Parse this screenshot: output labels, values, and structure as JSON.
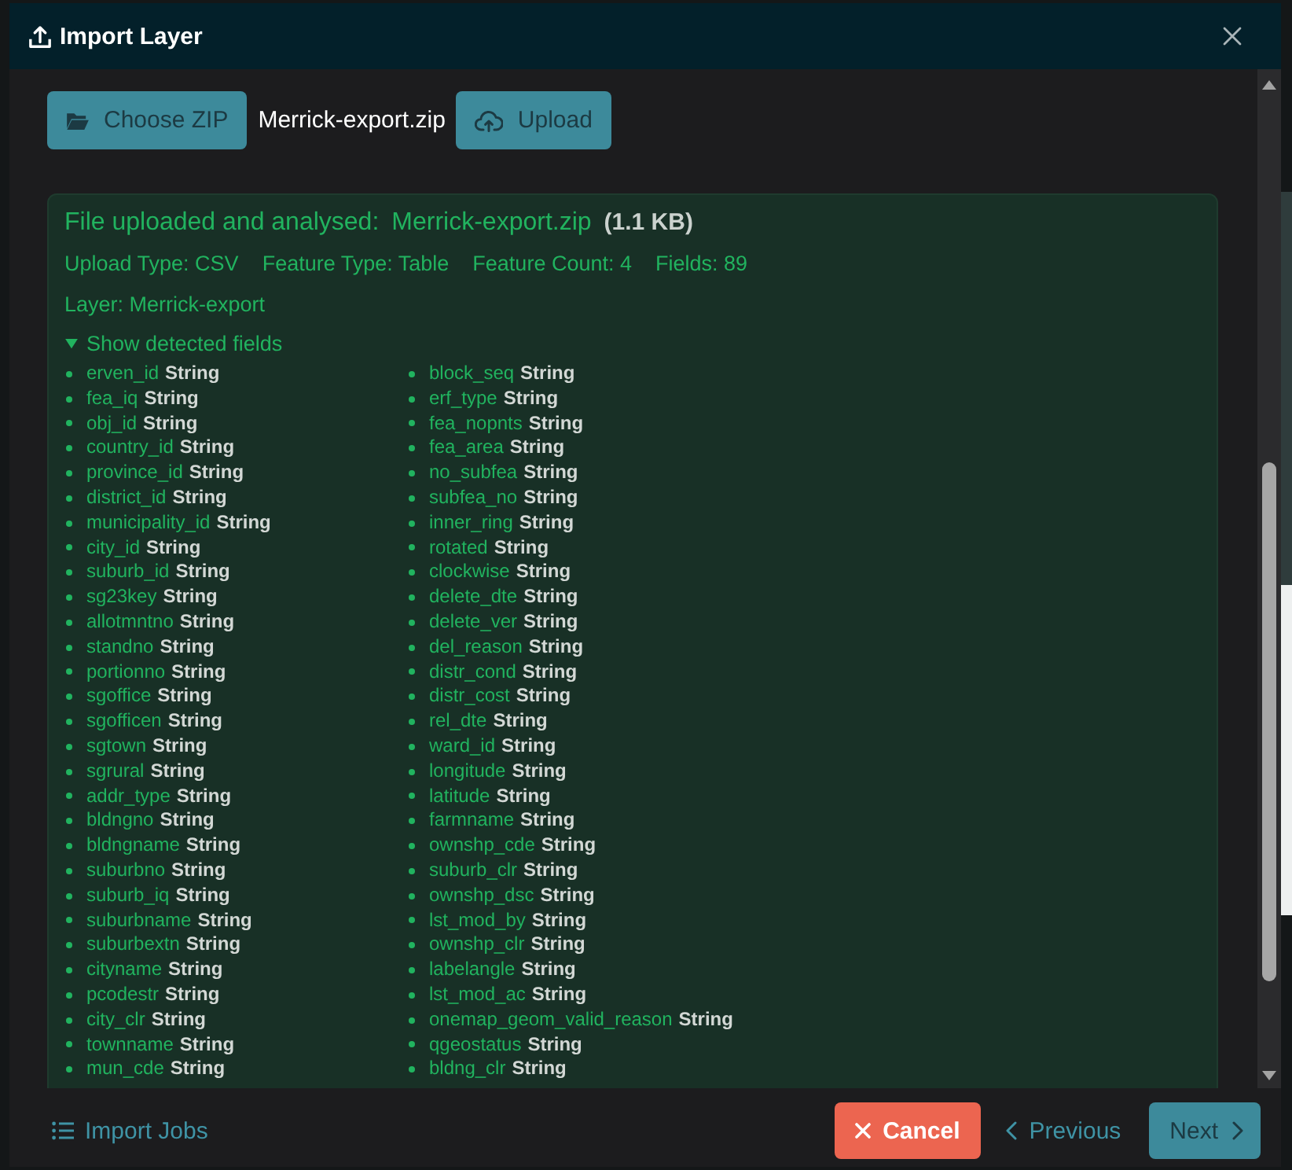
{
  "window": {
    "title": "Import Layer"
  },
  "toolbar": {
    "choose_button": "Choose ZIP",
    "file_name": "Merrick-export.zip",
    "upload_button": "Upload"
  },
  "result": {
    "heading": "File uploaded and analysed:",
    "file_name": "Merrick-export.zip",
    "size": "(1.1 KB)",
    "stats": [
      "Upload Type: CSV",
      "Feature Type: Table",
      "Feature Count: 4",
      "Fields: 89"
    ],
    "layer": "Layer: Merrick-export",
    "fields_toggle": {
      "label": "Show detected fields",
      "expanded": true
    },
    "fields": [
      {
        "name": "erven_id",
        "type": "String"
      },
      {
        "name": "fea_iq",
        "type": "String"
      },
      {
        "name": "obj_id",
        "type": "String"
      },
      {
        "name": "country_id",
        "type": "String"
      },
      {
        "name": "province_id",
        "type": "String"
      },
      {
        "name": "district_id",
        "type": "String"
      },
      {
        "name": "municipality_id",
        "type": "String"
      },
      {
        "name": "city_id",
        "type": "String"
      },
      {
        "name": "suburb_id",
        "type": "String"
      },
      {
        "name": "sg23key",
        "type": "String"
      },
      {
        "name": "allotmntno",
        "type": "String"
      },
      {
        "name": "standno",
        "type": "String"
      },
      {
        "name": "portionno",
        "type": "String"
      },
      {
        "name": "sgoffice",
        "type": "String"
      },
      {
        "name": "sgofficen",
        "type": "String"
      },
      {
        "name": "sgtown",
        "type": "String"
      },
      {
        "name": "sgrural",
        "type": "String"
      },
      {
        "name": "addr_type",
        "type": "String"
      },
      {
        "name": "bldngno",
        "type": "String"
      },
      {
        "name": "bldngname",
        "type": "String"
      },
      {
        "name": "suburbno",
        "type": "String"
      },
      {
        "name": "suburb_iq",
        "type": "String"
      },
      {
        "name": "suburbname",
        "type": "String"
      },
      {
        "name": "suburbextn",
        "type": "String"
      },
      {
        "name": "cityname",
        "type": "String"
      },
      {
        "name": "pcodestr",
        "type": "String"
      },
      {
        "name": "city_clr",
        "type": "String"
      },
      {
        "name": "townname",
        "type": "String"
      },
      {
        "name": "mun_cde",
        "type": "String"
      },
      {
        "name": "block_seq",
        "type": "String"
      },
      {
        "name": "erf_type",
        "type": "String"
      },
      {
        "name": "fea_nopnts",
        "type": "String"
      },
      {
        "name": "fea_area",
        "type": "String"
      },
      {
        "name": "no_subfea",
        "type": "String"
      },
      {
        "name": "subfea_no",
        "type": "String"
      },
      {
        "name": "inner_ring",
        "type": "String"
      },
      {
        "name": "rotated",
        "type": "String"
      },
      {
        "name": "clockwise",
        "type": "String"
      },
      {
        "name": "delete_dte",
        "type": "String"
      },
      {
        "name": "delete_ver",
        "type": "String"
      },
      {
        "name": "del_reason",
        "type": "String"
      },
      {
        "name": "distr_cond",
        "type": "String"
      },
      {
        "name": "distr_cost",
        "type": "String"
      },
      {
        "name": "rel_dte",
        "type": "String"
      },
      {
        "name": "ward_id",
        "type": "String"
      },
      {
        "name": "longitude",
        "type": "String"
      },
      {
        "name": "latitude",
        "type": "String"
      },
      {
        "name": "farmname",
        "type": "String"
      },
      {
        "name": "ownshp_cde",
        "type": "String"
      },
      {
        "name": "suburb_clr",
        "type": "String"
      },
      {
        "name": "ownshp_dsc",
        "type": "String"
      },
      {
        "name": "lst_mod_by",
        "type": "String"
      },
      {
        "name": "ownshp_clr",
        "type": "String"
      },
      {
        "name": "labelangle",
        "type": "String"
      },
      {
        "name": "lst_mod_ac",
        "type": "String"
      },
      {
        "name": "onemap_geom_valid_reason",
        "type": "String"
      },
      {
        "name": "qgeostatus",
        "type": "String"
      },
      {
        "name": "bldng_clr",
        "type": "String"
      }
    ]
  },
  "footer": {
    "jobs_link": "Import Jobs",
    "cancel": "Cancel",
    "previous": "Previous",
    "next": "Next"
  }
}
